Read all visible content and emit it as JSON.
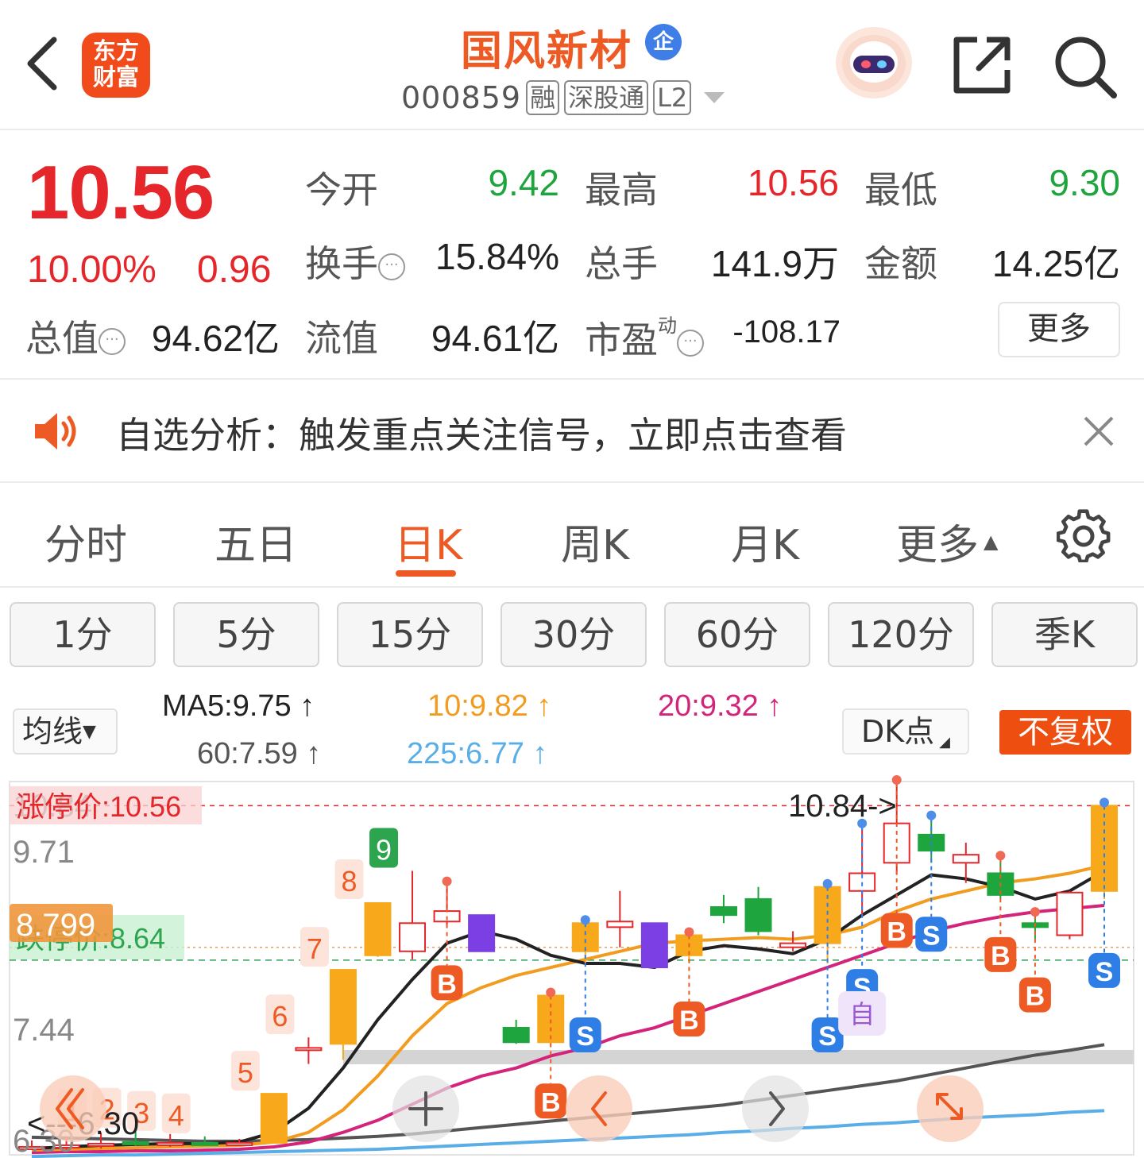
{
  "header": {
    "logo_text_1": "东方",
    "logo_text_2": "财富",
    "stock_name": "国风新材",
    "badge": "企",
    "code": "000859",
    "tags": [
      "融",
      "深股通",
      "L2"
    ]
  },
  "quote": {
    "price": "10.56",
    "change_pct": "10.00%",
    "change": "0.96",
    "open_label": "今开",
    "open": "9.42",
    "high_label": "最高",
    "high": "10.56",
    "low_label": "最低",
    "low": "9.30",
    "turnover_label": "换手",
    "turnover": "15.84%",
    "volume_label": "总手",
    "volume": "141.9万",
    "amount_label": "金额",
    "amount": "14.25亿",
    "mcap_label": "总值",
    "mcap": "94.62亿",
    "float_label": "流值",
    "float": "94.61亿",
    "pe_label": "市盈",
    "pe_sup": "动",
    "pe": "-108.17",
    "more": "更多"
  },
  "notice": {
    "text": "自选分析：触发重点关注信号，立即点击查看"
  },
  "period_tabs": [
    "分时",
    "五日",
    "日K",
    "周K",
    "月K",
    "更多"
  ],
  "minute_buttons": [
    "1分",
    "5分",
    "15分",
    "30分",
    "60分",
    "120分",
    "季K"
  ],
  "ma_legend": {
    "select": "均线",
    "ma5": "MA5:9.75",
    "ma10": "10:9.82",
    "ma20": "20:9.32",
    "ma60": "60:7.59",
    "ma225": "225:6.77",
    "dk": "DK点",
    "fuquan": "不复权"
  },
  "colors": {
    "up": "#e5262a",
    "down": "#1ea53d",
    "accent": "#ee5a24",
    "ma5": "#222222",
    "ma10": "#f29c1f",
    "ma20": "#d4237a",
    "ma60": "#555555",
    "ma225": "#5aaee8"
  },
  "chart_data": {
    "type": "candlestick",
    "y_labels": [
      "10.84",
      "9.71",
      "8.799",
      "7.44",
      "6.30"
    ],
    "limit_up_label": "涨停价:10.56",
    "limit_down_label": "跌停价:8.64",
    "high_marker": "10.84->",
    "low_marker": "<---6.30",
    "candles": [
      {
        "o": 6.3,
        "c": 6.32,
        "h": 6.4,
        "l": 6.28,
        "up": true
      },
      {
        "o": 6.32,
        "c": 6.34,
        "h": 6.45,
        "l": 6.28,
        "up": true
      },
      {
        "o": 6.34,
        "c": 6.36,
        "h": 6.5,
        "l": 6.3,
        "up": true
      },
      {
        "o": 6.38,
        "c": 6.36,
        "h": 6.52,
        "l": 6.33,
        "up": false
      },
      {
        "o": 6.36,
        "c": 6.37,
        "h": 6.48,
        "l": 6.32,
        "up": true
      },
      {
        "o": 6.37,
        "c": 6.36,
        "h": 6.45,
        "l": 6.33,
        "up": false
      },
      {
        "o": 6.36,
        "c": 6.37,
        "h": 6.42,
        "l": 6.34,
        "up": true
      },
      {
        "o": 6.37,
        "c": 6.98,
        "h": 6.98,
        "l": 6.37,
        "up": true
      },
      {
        "o": 7.55,
        "c": 7.55,
        "h": 7.68,
        "l": 7.35,
        "up": true
      },
      {
        "o": 7.6,
        "c": 8.52,
        "h": 8.52,
        "l": 7.4,
        "up": true
      },
      {
        "o": 8.7,
        "c": 9.35,
        "h": 9.36,
        "l": 8.68,
        "up": true
      },
      {
        "o": 8.75,
        "c": 9.1,
        "h": 9.75,
        "l": 8.65,
        "up": true
      },
      {
        "o": 9.12,
        "c": 9.25,
        "h": 9.58,
        "l": 9.05,
        "up": true
      },
      {
        "o": 9.2,
        "c": 8.75,
        "h": 9.2,
        "l": 8.75,
        "up": false
      },
      {
        "o": 7.8,
        "c": 7.62,
        "h": 7.9,
        "l": 7.6,
        "up": false
      },
      {
        "o": 7.62,
        "c": 8.2,
        "h": 8.2,
        "l": 7.58,
        "up": true
      },
      {
        "o": 8.75,
        "c": 9.1,
        "h": 9.1,
        "l": 8.6,
        "up": true
      },
      {
        "o": 9.05,
        "c": 9.12,
        "h": 9.5,
        "l": 8.8,
        "up": true
      },
      {
        "o": 9.1,
        "c": 8.55,
        "h": 9.1,
        "l": 8.55,
        "up": false
      },
      {
        "o": 8.7,
        "c": 8.95,
        "h": 8.95,
        "l": 8.6,
        "up": true
      },
      {
        "o": 9.3,
        "c": 9.2,
        "h": 9.45,
        "l": 9.1,
        "up": false
      },
      {
        "o": 9.4,
        "c": 9.0,
        "h": 9.55,
        "l": 8.95,
        "up": false
      },
      {
        "o": 8.8,
        "c": 8.85,
        "h": 9.0,
        "l": 8.75,
        "up": true
      },
      {
        "o": 8.85,
        "c": 9.55,
        "h": 9.55,
        "l": 8.6,
        "up": true
      },
      {
        "o": 9.5,
        "c": 9.72,
        "h": 10.3,
        "l": 9.2,
        "up": true
      },
      {
        "o": 9.85,
        "c": 10.34,
        "h": 10.84,
        "l": 9.7,
        "up": true
      },
      {
        "o": 10.2,
        "c": 10.0,
        "h": 10.4,
        "l": 9.85,
        "up": false
      },
      {
        "o": 9.95,
        "c": 9.85,
        "h": 10.1,
        "l": 9.6,
        "up": true
      },
      {
        "o": 9.72,
        "c": 9.45,
        "h": 9.9,
        "l": 9.4,
        "up": false
      },
      {
        "o": 9.1,
        "c": 9.05,
        "h": 9.2,
        "l": 8.9,
        "up": false
      },
      {
        "o": 9.48,
        "c": 8.95,
        "h": 9.5,
        "l": 8.9,
        "up": true
      },
      {
        "o": 9.5,
        "c": 10.56,
        "h": 10.56,
        "l": 9.4,
        "up": true
      }
    ],
    "ma5": [
      6.3,
      6.32,
      6.34,
      6.35,
      6.36,
      6.36,
      6.38,
      6.5,
      6.8,
      7.3,
      7.9,
      8.4,
      8.85,
      9.0,
      8.9,
      8.7,
      8.6,
      8.6,
      8.55,
      8.75,
      8.82,
      8.78,
      8.72,
      8.9,
      9.2,
      9.45,
      9.7,
      9.65,
      9.55,
      9.4,
      9.5,
      9.75
    ],
    "ma10": [
      6.28,
      6.29,
      6.3,
      6.31,
      6.32,
      6.33,
      6.34,
      6.38,
      6.5,
      6.78,
      7.2,
      7.7,
      8.1,
      8.3,
      8.45,
      8.55,
      8.65,
      8.75,
      8.85,
      8.88,
      8.9,
      8.92,
      8.9,
      8.95,
      9.05,
      9.25,
      9.4,
      9.5,
      9.6,
      9.65,
      9.72,
      9.82
    ],
    "ma20": [
      6.25,
      6.26,
      6.26,
      6.27,
      6.27,
      6.28,
      6.29,
      6.32,
      6.38,
      6.5,
      6.65,
      6.85,
      7.05,
      7.2,
      7.3,
      7.45,
      7.55,
      7.7,
      7.8,
      7.95,
      8.1,
      8.25,
      8.4,
      8.55,
      8.7,
      8.85,
      9.0,
      9.1,
      9.18,
      9.24,
      9.28,
      9.32
    ],
    "ma60": [
      6.44,
      6.43,
      6.42,
      6.41,
      6.4,
      6.39,
      6.39,
      6.4,
      6.41,
      6.43,
      6.45,
      6.48,
      6.52,
      6.56,
      6.6,
      6.64,
      6.68,
      6.72,
      6.76,
      6.8,
      6.84,
      6.9,
      6.96,
      7.02,
      7.08,
      7.14,
      7.22,
      7.3,
      7.38,
      7.46,
      7.52,
      7.59
    ],
    "ma225": [
      6.2,
      6.21,
      6.22,
      6.22,
      6.23,
      6.24,
      6.25,
      6.26,
      6.27,
      6.28,
      6.29,
      6.31,
      6.33,
      6.35,
      6.37,
      6.39,
      6.41,
      6.43,
      6.45,
      6.47,
      6.5,
      6.52,
      6.55,
      6.57,
      6.6,
      6.62,
      6.65,
      6.68,
      6.7,
      6.72,
      6.75,
      6.77
    ],
    "day_markers": [
      {
        "i": 2,
        "t": "1"
      },
      {
        "i": 3,
        "t": "2"
      },
      {
        "i": 4,
        "t": "3"
      },
      {
        "i": 5,
        "t": "4"
      },
      {
        "i": 7,
        "t": "5"
      },
      {
        "i": 8,
        "t": "6"
      },
      {
        "i": 9,
        "t": "7"
      },
      {
        "i": 10,
        "t": "8"
      },
      {
        "i": 11,
        "t": "9"
      }
    ],
    "signals": [
      {
        "i": 12,
        "t": "B"
      },
      {
        "i": 15,
        "t": "B"
      },
      {
        "i": 16,
        "t": "S"
      },
      {
        "i": 19,
        "t": "B"
      },
      {
        "i": 23,
        "t": "S"
      },
      {
        "i": 24,
        "t": "S"
      },
      {
        "i": 25,
        "t": "B"
      },
      {
        "i": 26,
        "t": "S"
      },
      {
        "i": 28,
        "t": "B"
      },
      {
        "i": 29,
        "t": "B"
      },
      {
        "i": 31,
        "t": "S"
      }
    ],
    "self_marker": "自"
  }
}
